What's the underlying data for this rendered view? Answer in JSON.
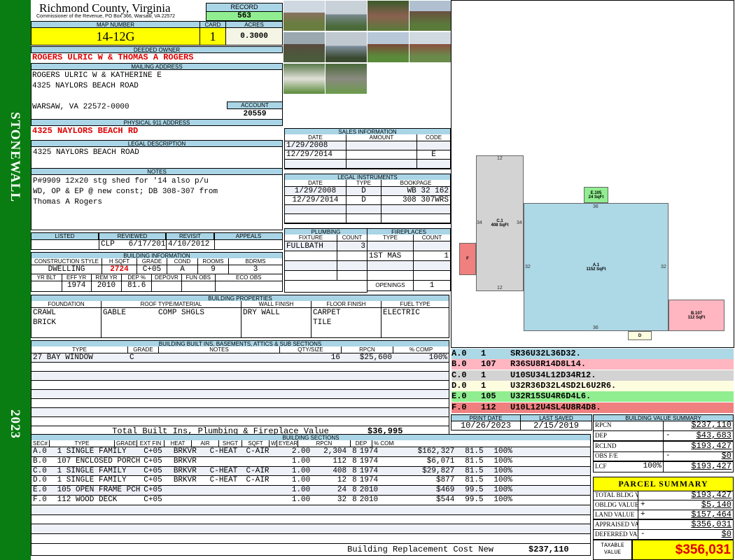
{
  "side": {
    "district": "STONEWALL",
    "year": "2023"
  },
  "header": {
    "county": "Richmond County, Virginia",
    "subtitle": "Commissioner of the Revenue, PO Box 366, Warsaw, VA 22572",
    "record_label": "RECORD",
    "record": "563",
    "map_label": "MAP NUMBER",
    "map": "14-12G",
    "card_label": "CARD",
    "card": "1",
    "acres_label": "ACRES",
    "acres": "0.3000"
  },
  "owner": {
    "label": "DEEDED OWNER",
    "value": "ROGERS ULRIC W & THOMAS A ROGERS"
  },
  "mailing": {
    "label": "MAILING ADDRESS",
    "line1": "ROGERS ULRIC W & KATHERINE E",
    "line2": "4325 NAYLORS BEACH ROAD",
    "line3": "WARSAW, VA 22572-0000",
    "account_label": "ACCOUNT",
    "account": "20559"
  },
  "physical": {
    "label": "PHYSICAL 911 ADDRESS",
    "value": "4325 NAYLORS BEACH RD"
  },
  "legal": {
    "label": "LEGAL DESCRIPTION",
    "value": "4325 NAYLORS BEACH ROAD"
  },
  "notes": {
    "label": "NOTES",
    "line1": "P#9909 12x20 stg shed for '14 also p/u",
    "line2": "WD, OP & EP @ new const; DB 308-307 from",
    "line3": "Thomas A Rogers"
  },
  "review": {
    "headers": [
      "LISTED",
      "REVIEWED",
      "REVISIT",
      "APPEALS"
    ],
    "values": [
      "",
      "CLP   6/17/2014",
      "4/10/2012",
      ""
    ]
  },
  "building_info": {
    "label": "BUILDING INFORMATION",
    "headers1": [
      "CONSTRUCTION STYLE",
      "H SQFT",
      "GRADE",
      "COND",
      "ROOMS",
      "BDRMS"
    ],
    "values1": [
      "DWELLING",
      "2724",
      "C+05",
      "A",
      "9",
      "3"
    ],
    "headers2": [
      "YR BLT",
      "EFF YR",
      "REM YR",
      "DEP %",
      "DEPOVR",
      "FUN OBS",
      "ECO OBS"
    ],
    "values2": [
      "",
      "1974",
      "2010",
      "81.6",
      "",
      "",
      ""
    ]
  },
  "sales": {
    "label": "SALES INFORMATION",
    "headers": [
      "DATE",
      "AMOUNT",
      "CODE"
    ],
    "rows": [
      [
        "1/29/2008",
        "",
        ""
      ],
      [
        "12/29/2014",
        "",
        "E"
      ],
      [
        "",
        "",
        ""
      ]
    ]
  },
  "instruments": {
    "label": "LEGAL INSTRUMENTS",
    "headers": [
      "DATE",
      "TYPE",
      "BOOKPAGE"
    ],
    "rows": [
      [
        "1/29/2008",
        "D",
        "WB 32 162"
      ],
      [
        "12/29/2014",
        "D",
        "308 307WRS"
      ],
      [
        "",
        "",
        ""
      ],
      [
        "",
        "",
        ""
      ]
    ]
  },
  "plumbing": {
    "label": "PLUMBING",
    "headers": [
      "FIXTURE",
      "COUNT"
    ],
    "rows": [
      [
        "FULLBATH",
        "3"
      ],
      [
        "",
        ""
      ],
      [
        "",
        ""
      ],
      [
        "",
        ""
      ]
    ]
  },
  "fireplaces": {
    "label": "FIREPLACES",
    "headers": [
      "TYPE",
      "COUNT"
    ],
    "rows": [
      [
        "",
        ""
      ],
      [
        "1ST MAS",
        "1"
      ],
      [
        "",
        ""
      ],
      [
        "",
        ""
      ]
    ],
    "openings_label": "OPENINGS",
    "openings": "1"
  },
  "properties": {
    "label": "BUILDING PROPERTIES",
    "headers": [
      "FOUNDATION",
      "ROOF TYPE/MATERIAL",
      "WALL FINISH",
      "FLOOR FINISH",
      "FUEL TYPE"
    ],
    "foundation": [
      "CRAWL",
      "BRICK"
    ],
    "roof": [
      "GABLE",
      "COMP SHGLS"
    ],
    "wall": [
      "DRY WALL"
    ],
    "floor": [
      "CARPET",
      "TILE"
    ],
    "fuel": [
      "ELECTRIC"
    ]
  },
  "built_ins": {
    "label": "BUILDING BUILT INS, BASEMENTS, ATTICS & SUB SECTIONS",
    "headers": [
      "TYPE",
      "GRADE",
      "NOTES",
      "QTY/SIZE",
      "RPCN",
      "% COMP"
    ],
    "rows": [
      [
        "27 BAY WINDOW",
        "C",
        "",
        "16",
        "$25,600",
        "100%"
      ],
      [
        "",
        "",
        "",
        "",
        "",
        ""
      ],
      [
        "",
        "",
        "",
        "",
        "",
        ""
      ],
      [
        "",
        "",
        "",
        "",
        "",
        ""
      ],
      [
        "",
        "",
        "",
        "",
        "",
        ""
      ],
      [
        "",
        "",
        "",
        "",
        "",
        ""
      ],
      [
        "",
        "",
        "",
        "",
        "",
        ""
      ],
      [
        "",
        "",
        "",
        "",
        "",
        ""
      ]
    ],
    "total_label": "Total Built Ins, Plumbing & Fireplace Value",
    "total": "$36,995"
  },
  "sections": {
    "label": "BUILDING SECTIONS",
    "headers": [
      "SEC#",
      "TYPE",
      "GRADE",
      "EXT FIN",
      "HEAT",
      "AIR",
      "SHGT",
      "SQFT",
      "WHGT",
      "EYEAR",
      "RPCN",
      "DEP",
      "% COMP"
    ],
    "rows": [
      [
        "A.0",
        "1 SINGLE FAMILY",
        "C+05",
        "BRKVR",
        "C-HEAT",
        "C-AIR",
        "2.00",
        "2,304",
        "8",
        "1974",
        "$162,327",
        "81.5",
        "100%"
      ],
      [
        "B.0",
        "107 ENCLOSED PORCH",
        "C+05",
        "BRKVR",
        "",
        "",
        "1.00",
        "112",
        "8",
        "1974",
        "$6,071",
        "81.5",
        "100%"
      ],
      [
        "C.0",
        "1 SINGLE FAMILY",
        "C+05",
        "BRKVR",
        "C-HEAT",
        "C-AIR",
        "1.00",
        "408",
        "8",
        "1974",
        "$29,827",
        "81.5",
        "100%"
      ],
      [
        "D.0",
        "1 SINGLE FAMILY",
        "C+05",
        "BRKVR",
        "C-HEAT",
        "C-AIR",
        "1.00",
        "12",
        "8",
        "1974",
        "$877",
        "81.5",
        "100%"
      ],
      [
        "E.0",
        "105 OPEN FRAME PCH",
        "C+05",
        "",
        "",
        "",
        "1.00",
        "24",
        "8",
        "2010",
        "$469",
        "99.5",
        "100%"
      ],
      [
        "F.0",
        "112 WOOD DECK",
        "C+05",
        "",
        "",
        "",
        "1.00",
        "32",
        "8",
        "2010",
        "$544",
        "99.5",
        "100%"
      ],
      [
        "",
        "",
        "",
        "",
        "",
        "",
        "",
        "",
        "",
        "",
        "",
        "",
        ""
      ],
      [
        "",
        "",
        "",
        "",
        "",
        "",
        "",
        "",
        "",
        "",
        "",
        "",
        ""
      ],
      [
        "",
        "",
        "",
        "",
        "",
        "",
        "",
        "",
        "",
        "",
        "",
        "",
        ""
      ],
      [
        "",
        "",
        "",
        "",
        "",
        "",
        "",
        "",
        "",
        "",
        "",
        "",
        ""
      ]
    ],
    "total_label": "Building Replacement Cost New",
    "total": "$237,110"
  },
  "sketch": {
    "shapes": [
      {
        "id": "A",
        "label": "A.1",
        "area": "1152 SqFt",
        "color": "#add8e6"
      },
      {
        "id": "B",
        "label": "B.107",
        "area": "112 SqFt",
        "color": "#ffb6c1"
      },
      {
        "id": "C",
        "label": "C.1",
        "area": "408 SqFt",
        "color": "#d3d3d3"
      },
      {
        "id": "D",
        "label": "D",
        "area": "",
        "color": "#fffde0"
      },
      {
        "id": "E",
        "label": "E.105",
        "area": "24 SqFt",
        "color": "#90ee90"
      },
      {
        "id": "F",
        "label": "F",
        "area": "",
        "color": "#f08080"
      }
    ],
    "dims": {
      "c_top": "12",
      "c_bottom": "12",
      "c_left": "34",
      "c_right": "34",
      "a_top": "36",
      "a_bottom": "36",
      "a_left": "32",
      "a_right": "32"
    },
    "codes": [
      [
        "A.0",
        "1",
        "SR36U32L36D32."
      ],
      [
        "B.0",
        "107",
        "R36SU8R14D8L14."
      ],
      [
        "C.0",
        "1",
        "U10SU34L12D34R12."
      ],
      [
        "D.0",
        "1",
        "U32R36D32L4SD2L6U2R6."
      ],
      [
        "E.0",
        "105",
        "U32R15SU4R6D4L6."
      ],
      [
        "F.0",
        "112",
        "U10L12U4SL4U8R4D8."
      ]
    ]
  },
  "dates": {
    "print_label": "PRINT DATE",
    "print": "10/26/2023",
    "saved_label": "LAST SAVED",
    "saved": "2/15/2019"
  },
  "value_summary": {
    "label": "BUILDING VALUE SUMMARY",
    "rows": [
      [
        "RPCN",
        "",
        "",
        "$237,110"
      ],
      [
        "DEP",
        "",
        "-",
        "$43,683"
      ],
      [
        "RCLND",
        "",
        "",
        "$193,427"
      ],
      [
        "OBS F/E",
        "",
        "-",
        "$0"
      ],
      [
        "LCF",
        "100%",
        "",
        "$193,427"
      ]
    ]
  },
  "parcel": {
    "label": "PARCEL SUMMARY",
    "rows": [
      [
        "TOTAL BLDG VALUE",
        "",
        "$193,427"
      ],
      [
        "OBLDG VALUE",
        "+",
        "$5,140"
      ],
      [
        "LAND VALUE",
        "+",
        "$157,464"
      ],
      [
        "APPRAISED VALUE",
        "",
        "$356,031"
      ],
      [
        "DEFERRED VALUE",
        "-",
        "$0"
      ]
    ],
    "taxable_label1": "TAXABLE",
    "taxable_label2": "VALUE",
    "taxable": "$356,031"
  },
  "colors": {
    "header": "#a9d5e6",
    "side": "#0a7d12",
    "highlight": "#ffff00",
    "record": "#90ee90",
    "red": "#dd0000"
  }
}
